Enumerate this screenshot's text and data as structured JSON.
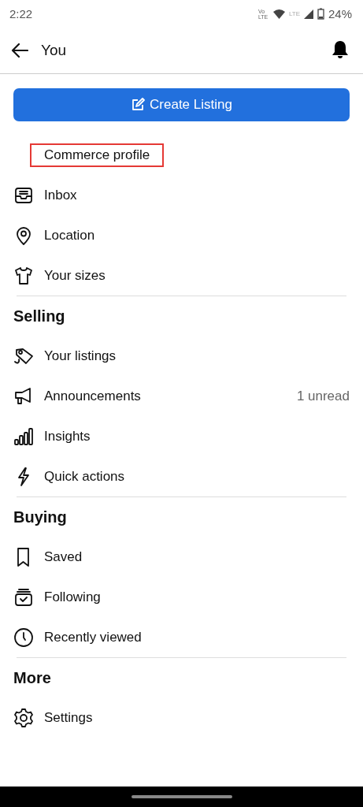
{
  "status_bar": {
    "time": "2:22",
    "volte": "Vo LTE",
    "network": "LTE",
    "battery": "24%"
  },
  "header": {
    "title": "You"
  },
  "create_button": {
    "label": "Create Listing"
  },
  "sections": [
    {
      "items": [
        {
          "label": "Commerce profile",
          "highlighted": true
        },
        {
          "label": "Inbox",
          "highlighted": false
        },
        {
          "label": "Location",
          "highlighted": false
        },
        {
          "label": "Your sizes",
          "highlighted": false
        }
      ]
    },
    {
      "title": "Selling",
      "items": [
        {
          "label": "Your listings",
          "highlighted": false
        },
        {
          "label": "Announcements",
          "badge": "1 unread",
          "highlighted": false
        },
        {
          "label": "Insights",
          "highlighted": false
        },
        {
          "label": "Quick actions",
          "highlighted": false
        }
      ]
    },
    {
      "title": "Buying",
      "items": [
        {
          "label": "Saved",
          "highlighted": false
        },
        {
          "label": "Following",
          "highlighted": false
        },
        {
          "label": "Recently viewed",
          "highlighted": false
        }
      ]
    },
    {
      "title": "More",
      "items": [
        {
          "label": "Settings",
          "highlighted": false
        }
      ]
    }
  ]
}
